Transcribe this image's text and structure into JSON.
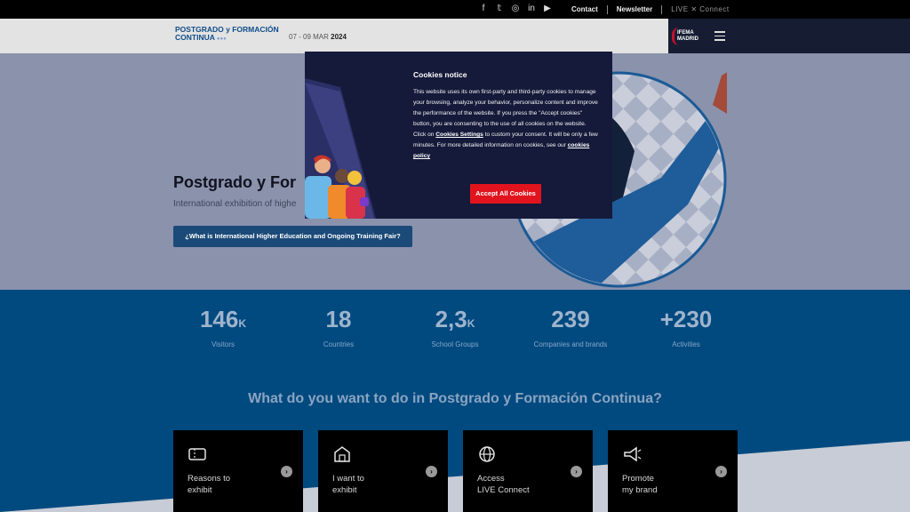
{
  "topbar": {
    "social": [
      "facebook-icon",
      "twitter-icon",
      "instagram-icon",
      "linkedin-icon",
      "youtube-icon"
    ],
    "contact": "Contact",
    "newsletter": "Newsletter",
    "live": "LIVE ✕ Connect"
  },
  "header": {
    "logo_line1": "POSTGRADO y FORMACIÓN",
    "logo_line2": "CONTINUA",
    "dates_prefix": "07 - 09 MAR",
    "dates_year": "2024",
    "ifema_line1": "IFEMA",
    "ifema_line2": "MADRID"
  },
  "hero": {
    "title": "Postgrado y For",
    "subtitle": "International exhibition of highe",
    "cta": "¿What is International Higher Education and Ongoing Training Fair?"
  },
  "cookie": {
    "title": "Cookies notice",
    "text_1": "This website uses its own first-party and third-party cookies to manage your browsing, analyze your behavior, personalize content and improve the performance of the website. If you press the \"Accept cookies\" button, you are consenting to the use of all cookies on the website. Click on ",
    "settings_link": "Cookies Settings",
    "text_2": " to custom your consent. It will be only a few minutes. For more detailed information on cookies, see our ",
    "policy_link": "cookies policy",
    "accept": "Accept All Cookies"
  },
  "stats": [
    {
      "num": "146",
      "unit": "K",
      "label": "Visitors"
    },
    {
      "num": "18",
      "unit": "",
      "label": "Countries"
    },
    {
      "num": "2,3",
      "unit": "K",
      "label": "School Groups"
    },
    {
      "num": "239",
      "unit": "",
      "label": "Companies and brands"
    },
    {
      "num": "+230",
      "unit": "",
      "label": "Activities"
    }
  ],
  "question": "What do you want to do in Postgrado y Formación Continua?",
  "cards": [
    {
      "icon": "ticket-icon",
      "label": "Reasons to\nexhibit"
    },
    {
      "icon": "building-icon",
      "label": "I want to\nexhibit"
    },
    {
      "icon": "globe-icon",
      "label": "Access\nLIVE Connect"
    },
    {
      "icon": "megaphone-icon",
      "label": "Promote\nmy brand"
    }
  ],
  "colors": {
    "brand_blue": "#004a80",
    "accent_red": "#e1141e",
    "modal_bg": "#151a3a"
  }
}
